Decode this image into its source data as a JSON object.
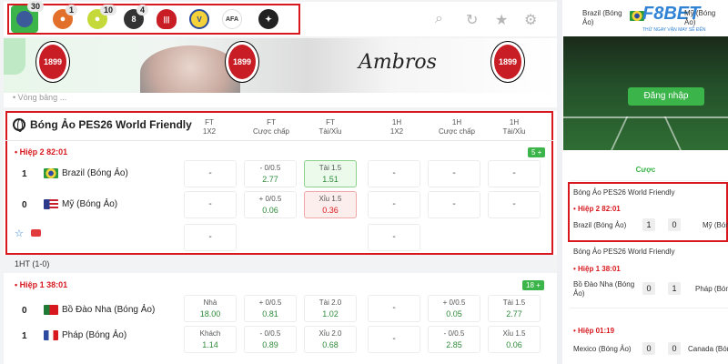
{
  "sports": [
    {
      "name": "esports-icon",
      "count": "30",
      "color": "#3a5a9a"
    },
    {
      "name": "basketball-icon",
      "count": "1",
      "color": "#e3702a"
    },
    {
      "name": "tennis-icon",
      "count": "10",
      "color": "#c5d93a"
    },
    {
      "name": "billiards-icon",
      "count": "4",
      "color": "#333333"
    },
    {
      "name": "ac-milan-icon",
      "count": "",
      "color": "#c81d25"
    },
    {
      "name": "villarreal-icon",
      "count": "",
      "color": "#f4d23a"
    },
    {
      "name": "afa-icon",
      "count": "",
      "color": "#ffffff"
    },
    {
      "name": "team-logo-icon",
      "count": "",
      "color": "#222222"
    }
  ],
  "tools": [
    "search-icon",
    "refresh-icon",
    "star-icon",
    "gear-icon"
  ],
  "banner": {
    "badge_text": "1899",
    "signature": "Ambros"
  },
  "strip_text": "• Vòng bảng ...",
  "headers": [
    {
      "line1": "FT",
      "line2": "1X2"
    },
    {
      "line1": "FT",
      "line2": "Cược chấp"
    },
    {
      "line1": "FT",
      "line2": "Tài/Xỉu"
    },
    {
      "line1": "1H",
      "line2": "1X2"
    },
    {
      "line1": "1H",
      "line2": "Cược chấp"
    },
    {
      "line1": "1H",
      "line2": "Tài/Xỉu"
    }
  ],
  "match1": {
    "league": "Bóng Ảo PES26 World Friendly",
    "period": "• Hiệp 2 82:01",
    "more": "5 +",
    "home": {
      "score": "1",
      "name": "Brazil (Bóng Ảo)"
    },
    "away": {
      "score": "0",
      "name": "Mỹ (Bóng Ảo)"
    },
    "home_odds": [
      {
        "t": "-",
        "v": ""
      },
      {
        "t": "- 0/0.5",
        "v": "2.77"
      },
      {
        "t": "Tài 1.5",
        "v": "1.51"
      },
      {
        "t": "-",
        "v": ""
      },
      {
        "t": "-",
        "v": ""
      },
      {
        "t": "-",
        "v": ""
      }
    ],
    "away_odds": [
      {
        "t": "-",
        "v": ""
      },
      {
        "t": "+ 0/0.5",
        "v": "0.06"
      },
      {
        "t": "Xỉu 1.5",
        "v": "0.36"
      },
      {
        "t": "-",
        "v": ""
      },
      {
        "t": "-",
        "v": ""
      },
      {
        "t": "-",
        "v": ""
      }
    ],
    "draw": [
      "-",
      "-"
    ]
  },
  "ht_text": "1HT (1-0)",
  "match2": {
    "period": "• Hiệp 1 38:01",
    "more": "18 +",
    "home": {
      "score": "0",
      "name": "Bồ Đào Nha (Bóng Ảo)"
    },
    "away": {
      "score": "1",
      "name": "Pháp (Bóng Ảo)"
    },
    "home_odds": [
      {
        "t": "Nhà",
        "v": "18.00"
      },
      {
        "t": "+ 0/0.5",
        "v": "0.81"
      },
      {
        "t": "Tài 2.0",
        "v": "1.02"
      },
      {
        "t": "-",
        "v": ""
      },
      {
        "t": "+ 0/0.5",
        "v": "0.05"
      },
      {
        "t": "Tài 1.5",
        "v": "2.77"
      }
    ],
    "away_odds": [
      {
        "t": "Khách",
        "v": "1.14"
      },
      {
        "t": "- 0/0.5",
        "v": "0.89"
      },
      {
        "t": "Xỉu 2.0",
        "v": "0.68"
      },
      {
        "t": "-",
        "v": ""
      },
      {
        "t": "- 0/0.5",
        "v": "2.85"
      },
      {
        "t": "Xỉu 1.5",
        "v": "0.06"
      }
    ]
  },
  "right": {
    "home_team": "Brazil (Bóng Ảo)",
    "away_team": "Mỹ (Bóng Ảo)",
    "logo": "F8BET",
    "tagline": "THỬ NGAY VẬN MAY SẼ ĐẾN",
    "login": "Đăng nhập",
    "tab": "Cược",
    "games": [
      {
        "league": "Bóng Ảo PES26 World Friendly",
        "period": "• Hiệp 2 82:01",
        "home": "Brazil (Bóng Ảo)",
        "hs": "1",
        "as": "0",
        "away": "Mỹ (Bóng Ảo)"
      },
      {
        "league": "Bóng Ảo PES26 World Friendly",
        "period": "• Hiệp 1 38:01",
        "home": "Bồ Đào Nha (Bóng Ảo)",
        "hs": "0",
        "as": "1",
        "away": "Pháp (Bóng Ảo)"
      },
      {
        "league": "",
        "period": "• Hiệp 01:19",
        "home": "Mexico (Bóng Ảo)",
        "hs": "0",
        "as": "0",
        "away": "Canada (Bóng"
      }
    ]
  }
}
